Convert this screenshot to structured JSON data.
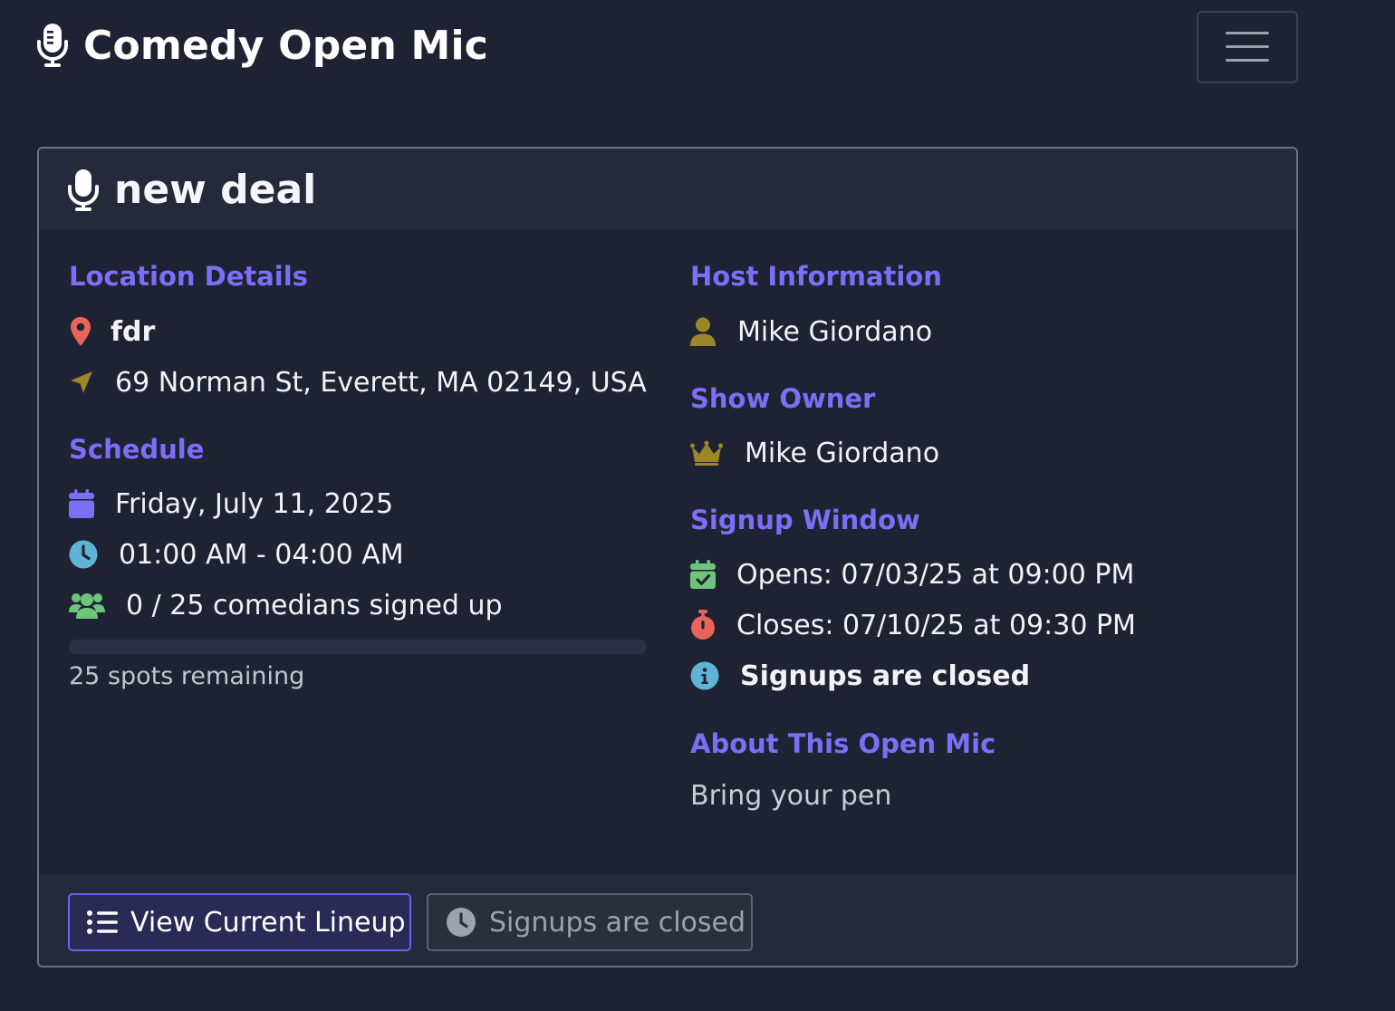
{
  "navbar": {
    "brand_title": "Comedy Open Mic",
    "brand_icon": "microphone-lines-icon",
    "menu_icon": "hamburger-menu-icon"
  },
  "show": {
    "title": "new deal",
    "title_icon": "microphone-icon"
  },
  "location": {
    "section_title": "Location Details",
    "venue_name": "fdr",
    "address": "69 Norman St, Everett, MA 02149, USA",
    "venue_icon": "map-pin-icon",
    "address_icon": "location-arrow-icon"
  },
  "schedule": {
    "section_title": "Schedule",
    "date": "Friday, July 11, 2025",
    "time": "01:00 AM - 04:00 AM",
    "signups": "0 / 25 comedians signed up",
    "signed_up_count": 0,
    "capacity": 25,
    "spots_remaining": "25 spots remaining",
    "date_icon": "calendar-icon",
    "time_icon": "clock-icon",
    "signups_icon": "users-icon"
  },
  "host": {
    "section_title": "Host Information",
    "name": "Mike Giordano",
    "icon": "user-icon"
  },
  "owner": {
    "section_title": "Show Owner",
    "name": "Mike Giordano",
    "icon": "crown-icon"
  },
  "signup_window": {
    "section_title": "Signup Window",
    "opens": "Opens: 07/03/25 at 09:00 PM",
    "closes": "Closes: 07/10/25 at 09:30 PM",
    "status": "Signups are closed",
    "opens_icon": "calendar-check-icon",
    "closes_icon": "stopwatch-icon",
    "status_icon": "info-circle-icon"
  },
  "about": {
    "section_title": "About This Open Mic",
    "text": "Bring your pen"
  },
  "footer": {
    "lineup_button_label": "View Current Lineup",
    "closed_button_label": "Signups are closed",
    "lineup_icon": "list-icon",
    "closed_icon": "clock-icon"
  },
  "colors": {
    "background": "#1e2233",
    "card_header": "#252a3a",
    "accent_purple": "#7d6ef6",
    "pin_red": "#e8645a",
    "gold": "#9c8629",
    "green": "#6fc47c",
    "teal": "#5fb3d6"
  }
}
